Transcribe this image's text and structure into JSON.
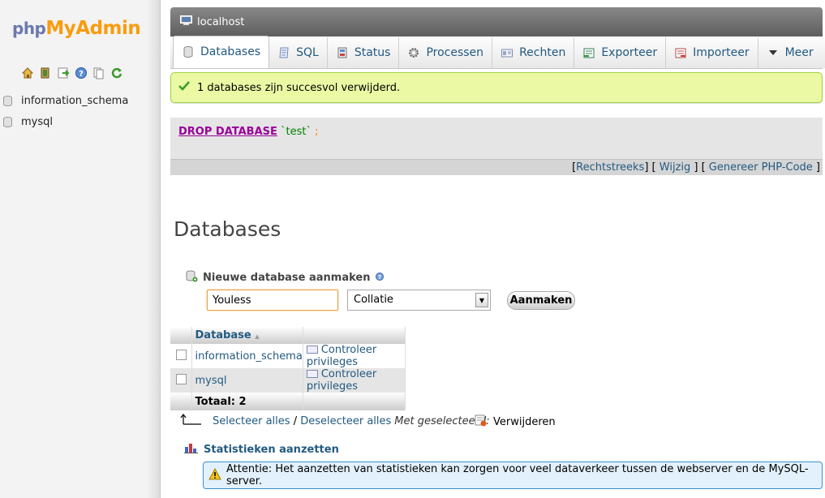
{
  "nav": {
    "logo": {
      "php": "php",
      "my": "My",
      "admin": "Admin"
    },
    "icons": [
      "home-icon",
      "exit-icon",
      "query-window-icon",
      "help-icon",
      "docs-icon",
      "reload-icon"
    ],
    "databases": [
      "information_schema",
      "mysql"
    ]
  },
  "serverbar": {
    "label": "localhost"
  },
  "tabs": [
    {
      "label": "Databases",
      "icon": "database-icon"
    },
    {
      "label": "SQL",
      "icon": "sql-icon"
    },
    {
      "label": "Status",
      "icon": "status-icon"
    },
    {
      "label": "Processen",
      "icon": "process-icon"
    },
    {
      "label": "Rechten",
      "icon": "rights-icon"
    },
    {
      "label": "Exporteer",
      "icon": "export-icon"
    },
    {
      "label": "Importeer",
      "icon": "import-icon"
    },
    {
      "label": "Meer",
      "icon": "chevron-down-icon"
    }
  ],
  "success": {
    "message": "1 databases zijn succesvol verwijderd."
  },
  "sql": {
    "keyword": "DROP DATABASE",
    "name": "`test`",
    "terminator": ";",
    "links": {
      "direct": "Rechtstreeks",
      "edit": "Wijzig",
      "php": "Genereer PHP-Code"
    }
  },
  "page": {
    "title": "Databases"
  },
  "create": {
    "heading": "Nieuwe database aanmaken",
    "name_value": "Youless",
    "collation": "Collatie",
    "button": "Aanmaken"
  },
  "table": {
    "header": "Database",
    "rows": [
      {
        "name": "information_schema",
        "action": "Controleer privileges"
      },
      {
        "name": "mysql",
        "action": "Controleer privileges"
      }
    ],
    "total": "Totaal: 2"
  },
  "selection": {
    "select_all": "Selecteer alles",
    "separator": "/",
    "deselect_all": "Deselecteer alles",
    "with_selected": "Met geselecteerd:",
    "delete": "Verwijderen"
  },
  "stats": {
    "link": "Statistieken aanzetten",
    "notice": "Attentie: Het aanzetten van statistieken kan zorgen voor veel dataverkeer tussen de webserver en de MySQL-server."
  },
  "colors": {
    "link": "#235a81",
    "success_bg": "#ebf8a4",
    "notice_bg": "#e3f1fd",
    "keyword": "#990099"
  }
}
